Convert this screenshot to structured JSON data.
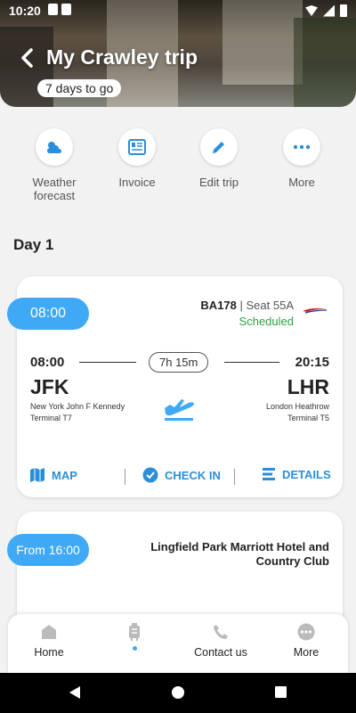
{
  "status_bar": {
    "time": "10:20"
  },
  "header": {
    "title": "My Crawley trip",
    "days_badge": "7 days to go"
  },
  "actions": [
    {
      "label": "Weather forecast",
      "icon": "weather-icon"
    },
    {
      "label": "Invoice",
      "icon": "invoice-icon"
    },
    {
      "label": "Edit trip",
      "icon": "pencil-icon"
    },
    {
      "label": "More",
      "icon": "more-icon"
    }
  ],
  "day": {
    "title": "Day 1"
  },
  "flight": {
    "time": "08:00",
    "number": "BA178",
    "seat": "Seat 55A",
    "status": "Scheduled",
    "departure_time": "08:00",
    "arrival_time": "20:15",
    "duration": "7h 15m",
    "from_code": "JFK",
    "from_name": "New York John F Kennedy",
    "from_terminal": "Terminal T7",
    "to_code": "LHR",
    "to_name": "London Heathrow",
    "to_terminal": "Terminal T5",
    "map_label": "MAP",
    "checkin_label": "CHECK IN",
    "details_label": "DETAILS"
  },
  "hotel": {
    "time": "From 16:00",
    "name": "Lingfield Park Marriott Hotel and Country Club"
  },
  "bottom_nav": [
    {
      "label": "Home"
    },
    {
      "label": ""
    },
    {
      "label": "Contact us"
    },
    {
      "label": "More"
    }
  ],
  "colors": {
    "accent": "#3fa9f5",
    "link": "#2a8fd9",
    "status_green": "#2ea043",
    "background": "#f2f2f2"
  }
}
